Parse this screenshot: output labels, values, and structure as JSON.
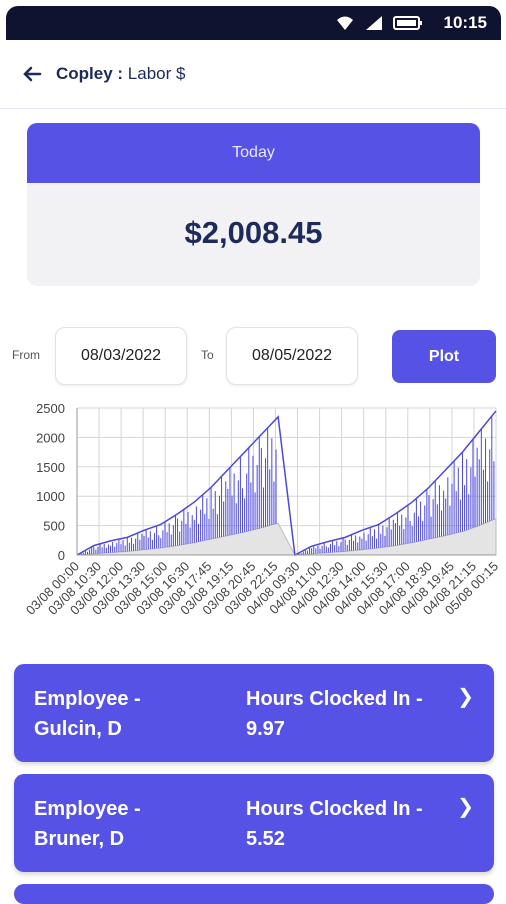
{
  "status": {
    "time": "10:15",
    "icons": [
      "wifi-icon",
      "signal-icon",
      "battery-icon"
    ]
  },
  "header": {
    "store": "Copley",
    "separator": " : ",
    "metric": "Labor $"
  },
  "summary": {
    "period": "Today",
    "amount": "$2,008.45"
  },
  "filters": {
    "from_label": "From",
    "from_value": "08/03/2022",
    "to_label": "To",
    "to_value": "08/05/2022",
    "plot_label": "Plot"
  },
  "chart_data": {
    "type": "area",
    "ylim": [
      0,
      2500
    ],
    "yticks": [
      "0",
      "500",
      "1000",
      "1500",
      "2000",
      "2500"
    ],
    "x_labels": [
      "03/08 00:00",
      "03/08 10:30",
      "03/08 12:00",
      "03/08 13:30",
      "03/08 15:00",
      "03/08 16:30",
      "03/08 17:45",
      "03/08 19:15",
      "03/08 20:45",
      "03/08 22:15",
      "04/08 09:30",
      "04/08 11:00",
      "04/08 12:30",
      "04/08 14:00",
      "04/08 15:30",
      "04/08 17:00",
      "04/08 18:30",
      "04/08 19:45",
      "04/08 21:15",
      "05/08 00:15"
    ],
    "series": [
      {
        "color": "#4b47e0",
        "values": [
          0,
          160,
          240,
          300,
          420,
          520,
          700,
          900,
          1150,
          1450,
          1750,
          2050,
          2350,
          0,
          150,
          230,
          300,
          420,
          520,
          700,
          900,
          1150,
          1450,
          1750,
          2100,
          2450
        ]
      },
      {
        "color": "#bdbdbd",
        "values": [
          0,
          20,
          40,
          60,
          90,
          120,
          160,
          210,
          270,
          330,
          390,
          460,
          540,
          0,
          20,
          40,
          60,
          90,
          120,
          160,
          210,
          270,
          330,
          400,
          500,
          620
        ]
      }
    ],
    "grid": true,
    "colors": {
      "spike": "#4b47e0",
      "baseline": "#bdbdbd",
      "fill": "#e4e4e4"
    }
  },
  "employees": [
    {
      "label": "Employee -",
      "name": "Gulcin, D",
      "hours_label": "Hours Clocked In -",
      "hours": "9.97"
    },
    {
      "label": "Employee -",
      "name": "Bruner, D",
      "hours_label": "Hours Clocked In -",
      "hours": "5.52"
    }
  ]
}
